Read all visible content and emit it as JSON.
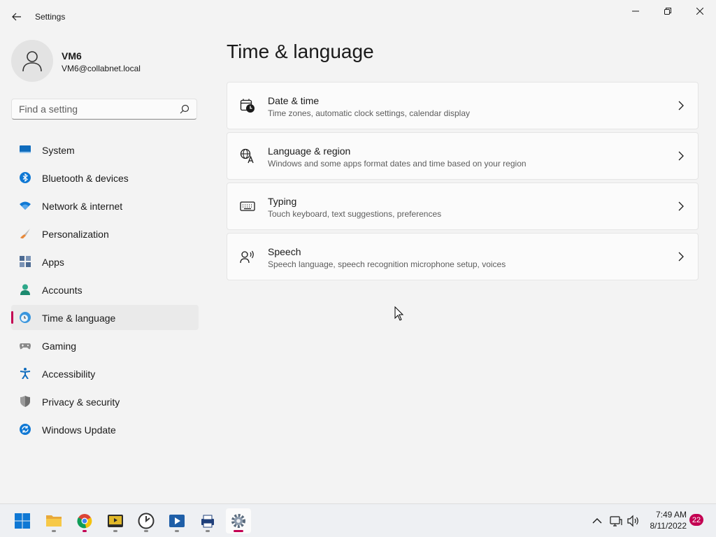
{
  "window": {
    "title": "Settings"
  },
  "user": {
    "name": "VM6",
    "email": "VM6@collabnet.local"
  },
  "search": {
    "placeholder": "Find a setting"
  },
  "nav": {
    "items": [
      {
        "label": "System",
        "icon": "monitor-icon",
        "selected": false
      },
      {
        "label": "Bluetooth & devices",
        "icon": "bluetooth-icon",
        "selected": false
      },
      {
        "label": "Network & internet",
        "icon": "wifi-icon",
        "selected": false
      },
      {
        "label": "Personalization",
        "icon": "brush-icon",
        "selected": false
      },
      {
        "label": "Apps",
        "icon": "apps-icon",
        "selected": false
      },
      {
        "label": "Accounts",
        "icon": "person-icon",
        "selected": false
      },
      {
        "label": "Time & language",
        "icon": "globe-clock-icon",
        "selected": true
      },
      {
        "label": "Gaming",
        "icon": "controller-icon",
        "selected": false
      },
      {
        "label": "Accessibility",
        "icon": "accessibility-icon",
        "selected": false
      },
      {
        "label": "Privacy & security",
        "icon": "shield-icon",
        "selected": false
      },
      {
        "label": "Windows Update",
        "icon": "update-icon",
        "selected": false
      }
    ]
  },
  "main": {
    "title": "Time & language",
    "cards": [
      {
        "title": "Date & time",
        "subtitle": "Time zones, automatic clock settings, calendar display",
        "icon": "calendar-clock-icon"
      },
      {
        "title": "Language & region",
        "subtitle": "Windows and some apps format dates and time based on your region",
        "icon": "language-icon"
      },
      {
        "title": "Typing",
        "subtitle": "Touch keyboard, text suggestions, preferences",
        "icon": "keyboard-icon"
      },
      {
        "title": "Speech",
        "subtitle": "Speech language, speech recognition microphone setup, voices",
        "icon": "speech-icon"
      }
    ]
  },
  "taskbar": {
    "apps": [
      "start-icon",
      "file-explorer-icon",
      "chrome-icon",
      "media-player-icon",
      "clock-app-icon",
      "video-app-icon",
      "print-app-icon",
      "settings-icon"
    ],
    "clock": {
      "time": "7:49 AM",
      "date": "8/11/2022"
    },
    "notifications": "22"
  },
  "colors": {
    "accent": "#c30052",
    "background": "#f3f3f3",
    "card": "#fbfbfb"
  }
}
